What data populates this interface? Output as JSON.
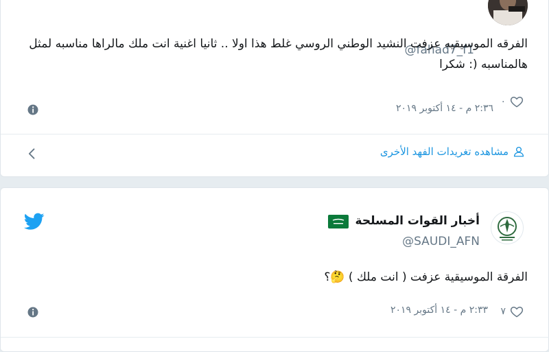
{
  "tweet1": {
    "handle": "@fahad7_f1",
    "text": "الفرقه الموسيقيه عزفت النشيد الوطني الروسي غلط هذا اولا .. ثانيا اغنية انت ملك مالراها مناسبه لمثل هالمناسبه (: شكرا",
    "likes": "٠",
    "date": "٢:٣٦ م - ١٤ أكتوبر ٢٠١٩",
    "more_link": "مشاهده تغريدات الفهد الأخرى"
  },
  "tweet2": {
    "name": "أخبار القوات المسلحة",
    "handle": "@SAUDI_AFN",
    "text": "الفرقة الموسيقية عزفت ( انت ملك ) 🤔؟",
    "likes": "٧",
    "date": "٢:٣٣ م - ١٤ أكتوبر ٢٠١٩"
  },
  "colors": {
    "twitter_blue": "#1da1f2",
    "link_blue": "#1b95e0",
    "muted": "#657786",
    "flag_green": "#0b7a3a"
  },
  "icons": [
    "heart-icon",
    "info-icon",
    "chevron-left-icon",
    "user-icon",
    "twitter-bird-icon",
    "saudi-flag-icon"
  ]
}
